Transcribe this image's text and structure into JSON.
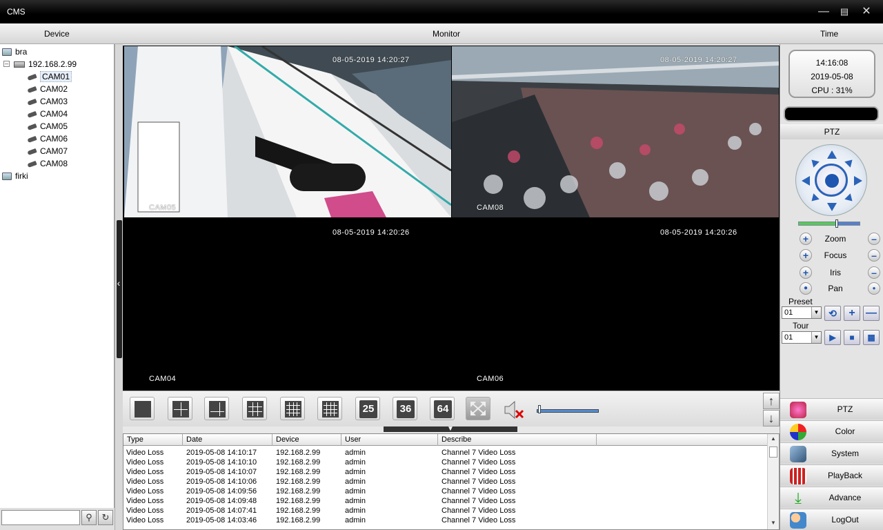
{
  "window": {
    "title": "CMS"
  },
  "header": {
    "device": "Device",
    "monitor": "Monitor",
    "time": "Time"
  },
  "tree": {
    "root": "bra",
    "dvr": "192.168.2.99",
    "cameras": [
      "CAM01",
      "CAM02",
      "CAM03",
      "CAM04",
      "CAM05",
      "CAM06",
      "CAM07",
      "CAM08"
    ],
    "other": "firki"
  },
  "search": {
    "placeholder": ""
  },
  "tiles": [
    {
      "timestamp": "08-05-2019 14:20:27",
      "name": "CAM05"
    },
    {
      "timestamp": "08-05-2019 14:20:27",
      "name": "CAM08"
    },
    {
      "timestamp": "08-05-2019 14:20:26",
      "name": "CAM04"
    },
    {
      "timestamp": "08-05-2019 14:20:26",
      "name": "CAM06"
    }
  ],
  "toolbar": {
    "n25": "25",
    "n36": "36",
    "n64": "64",
    "volume": 0.02
  },
  "log": {
    "columns": [
      "Type",
      "Date",
      "Device",
      "User",
      "Describe"
    ],
    "rows": [
      [
        "Video Loss",
        "2019-05-08 14:10:17",
        "192.168.2.99",
        "admin",
        "Channel 7 Video Loss"
      ],
      [
        "Video Loss",
        "2019-05-08 14:10:10",
        "192.168.2.99",
        "admin",
        "Channel 7 Video Loss"
      ],
      [
        "Video Loss",
        "2019-05-08 14:10:07",
        "192.168.2.99",
        "admin",
        "Channel 7 Video Loss"
      ],
      [
        "Video Loss",
        "2019-05-08 14:10:06",
        "192.168.2.99",
        "admin",
        "Channel 7 Video Loss"
      ],
      [
        "Video Loss",
        "2019-05-08 14:09:56",
        "192.168.2.99",
        "admin",
        "Channel 7 Video Loss"
      ],
      [
        "Video Loss",
        "2019-05-08 14:09:48",
        "192.168.2.99",
        "admin",
        "Channel 7 Video Loss"
      ],
      [
        "Video Loss",
        "2019-05-08 14:07:41",
        "192.168.2.99",
        "admin",
        "Channel 7 Video Loss"
      ],
      [
        "Video Loss",
        "2019-05-08 14:03:46",
        "192.168.2.99",
        "admin",
        "Channel 7 Video Loss"
      ]
    ]
  },
  "clock": {
    "time": "14:16:08",
    "date": "2019-05-08",
    "cpu": "CPU : 31%"
  },
  "ptz": {
    "header": "PTZ",
    "zoom": "Zoom",
    "focus": "Focus",
    "iris": "Iris",
    "pan": "Pan",
    "preset_label": "Preset",
    "preset_value": "01",
    "tour_label": "Tour",
    "tour_value": "01",
    "speed": 0.6
  },
  "menu": {
    "ptz": "PTZ",
    "color": "Color",
    "system": "System",
    "playback": "PlayBack",
    "advance": "Advance",
    "logout": "LogOut"
  },
  "colors": {
    "accent": "#1e56b0",
    "titlebar": "#000000"
  }
}
